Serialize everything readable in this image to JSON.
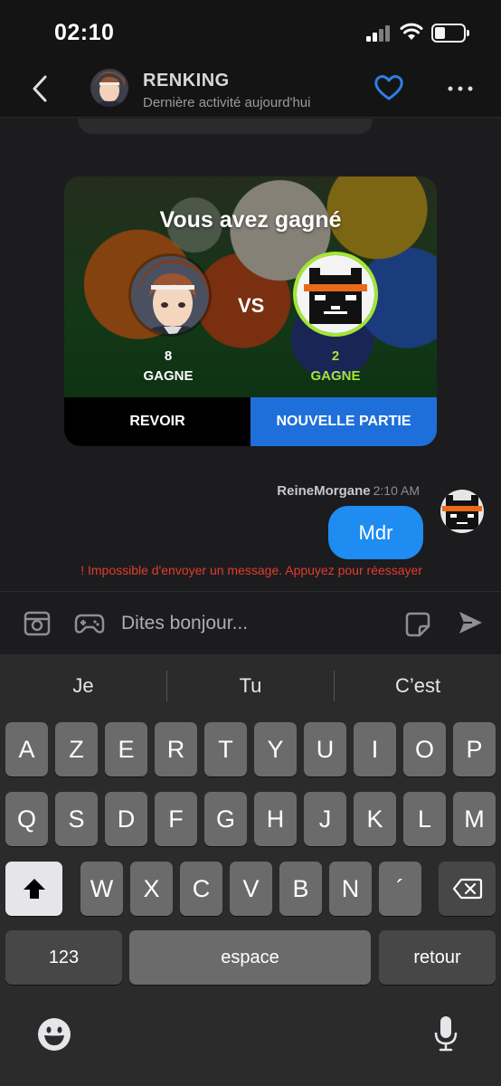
{
  "status_bar": {
    "time": "02:10"
  },
  "header": {
    "contact_name": "RENKING",
    "last_activity": "Dernière activité aujourd'hui"
  },
  "game_card": {
    "title": "Vous avez gagné",
    "vs_label": "VS",
    "player1": {
      "score": "8",
      "label": "GAGNE"
    },
    "player2": {
      "score": "2",
      "label": "GAGNE"
    },
    "rematch_button": "REVOIR",
    "new_game_button": "NOUVELLE PARTIE"
  },
  "message": {
    "sender": "ReineMorgane",
    "time": "2:10 AM",
    "text": "Mdr",
    "error": "! Impossible d'envoyer un message. Appuyez pour réessayer"
  },
  "composer": {
    "placeholder": "Dites bonjour..."
  },
  "keyboard": {
    "suggestions": [
      "Je",
      "Tu",
      "C’est"
    ],
    "row1": [
      "A",
      "Z",
      "E",
      "R",
      "T",
      "Y",
      "U",
      "I",
      "O",
      "P"
    ],
    "row2": [
      "Q",
      "S",
      "D",
      "F",
      "G",
      "H",
      "J",
      "K",
      "L",
      "M"
    ],
    "row3": [
      "W",
      "X",
      "C",
      "V",
      "B",
      "N",
      "´"
    ],
    "numbers_key": "123",
    "space_key": "espace",
    "return_key": "retour"
  },
  "colors": {
    "accent_blue": "#1e8cf0",
    "button_blue": "#1e6fd9",
    "win_green": "#a3e635",
    "error_red": "#e23b2e"
  },
  "icons": [
    "chevron-left-icon",
    "heart-icon",
    "more-icon",
    "photo-icon",
    "gamepad-icon",
    "sticker-icon",
    "send-icon",
    "shift-icon",
    "backspace-icon",
    "emoji-icon",
    "microphone-icon"
  ]
}
